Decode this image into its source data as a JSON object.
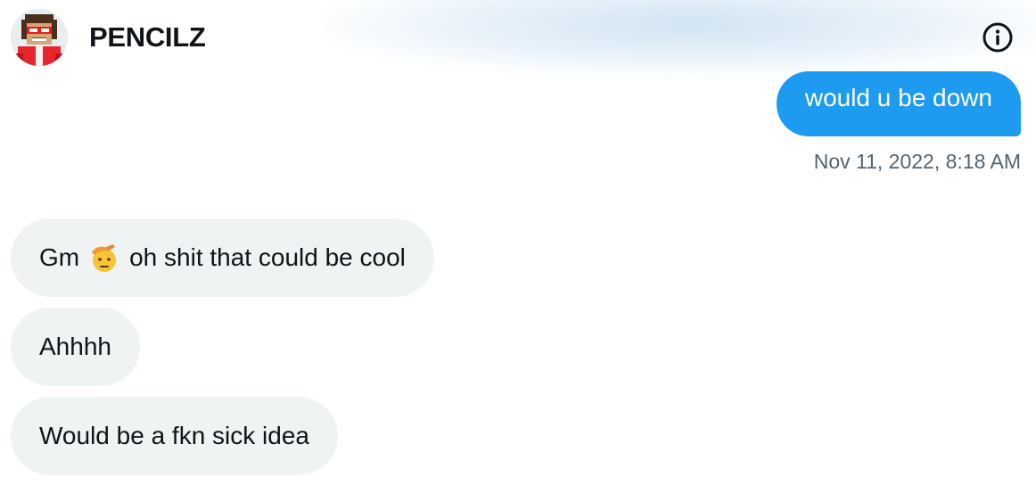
{
  "header": {
    "contact_name": "PENCILZ",
    "avatar_icon": "pixel-art-avatar-icon",
    "info_icon": "info-circle-icon"
  },
  "messages": {
    "sent": [
      {
        "text": "would u be down",
        "timestamp": "Nov 11, 2022, 8:18 AM"
      }
    ],
    "received": [
      {
        "before": "Gm",
        "emoji": "saluting-face-emoji",
        "after": "oh shit that could be cool"
      },
      {
        "text": "Ahhhh"
      },
      {
        "text": "Would be a fkn sick idea"
      }
    ]
  },
  "colors": {
    "sent_bubble": "#1d9bf0",
    "received_bubble": "#eff3f4",
    "timestamp": "#536471",
    "text": "#0f1419"
  }
}
